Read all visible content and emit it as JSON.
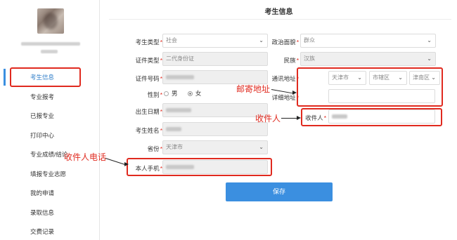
{
  "sidebar": {
    "items": [
      {
        "label": "考生信息"
      },
      {
        "label": "专业报考"
      },
      {
        "label": "已报专业"
      },
      {
        "label": "打印中心"
      },
      {
        "label": "专业成绩/结论"
      },
      {
        "label": "填报专业志愿"
      },
      {
        "label": "我的申请"
      },
      {
        "label": "录取信息"
      },
      {
        "label": "交费记录"
      }
    ]
  },
  "form": {
    "title": "考生信息",
    "candidate_type": {
      "label": "考生类型",
      "value": "社会"
    },
    "id_type": {
      "label": "证件类型",
      "value": "二代身份证"
    },
    "id_number": {
      "label": "证件号码"
    },
    "gender": {
      "label": "性别",
      "option_male": "男",
      "option_female": "女",
      "selected": "女"
    },
    "birth_date": {
      "label": "出生日期"
    },
    "name": {
      "label": "考生姓名"
    },
    "province": {
      "label": "省份",
      "value": "天津市"
    },
    "phone": {
      "label": "本人手机"
    },
    "political": {
      "label": "政治面貌",
      "value": "群众"
    },
    "ethnicity": {
      "label": "民族",
      "value": "汉族"
    },
    "mailing_address": {
      "label": "通讯地址",
      "province": "天津市",
      "city": "市辖区",
      "district": "津南区"
    },
    "detail_address": {
      "label": "详细地址"
    },
    "recipient": {
      "label": "收件人"
    },
    "save_label": "保存"
  },
  "annotations": {
    "mail_address": "邮寄地址",
    "recipient": "收件人",
    "recipient_phone": "收件人电话"
  },
  "colors": {
    "accent": "#3b8fe0",
    "highlight": "#e02a1f"
  }
}
